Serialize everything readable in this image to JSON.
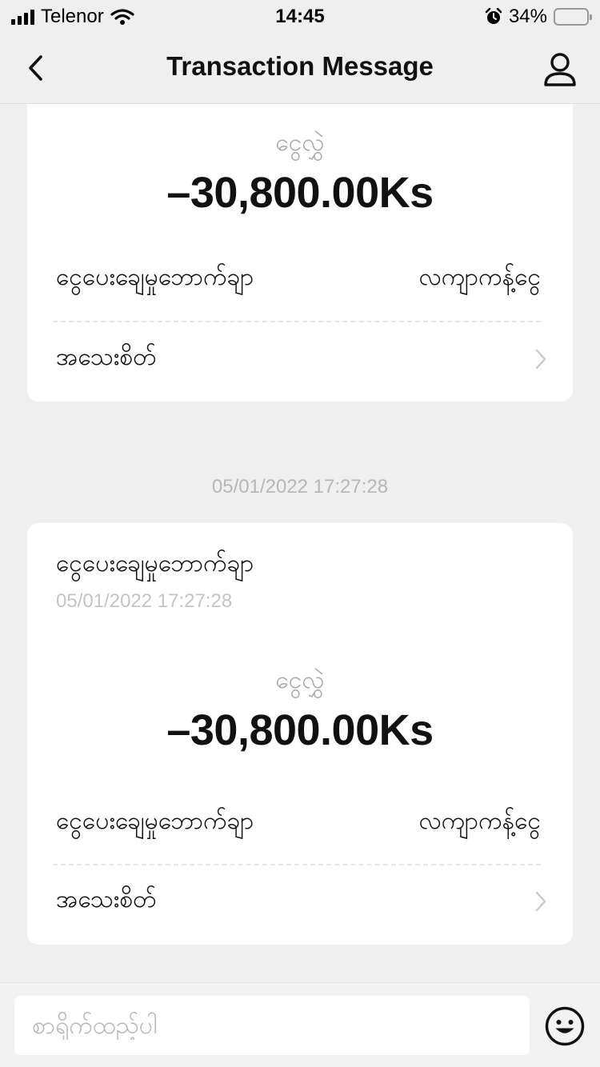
{
  "status_bar": {
    "carrier": "Telenor",
    "time": "14:45",
    "battery_percent": "34%",
    "battery_level": 0.34
  },
  "nav": {
    "title": "Transaction Message"
  },
  "cards": [
    {
      "amount_label": "ငွေလွှဲ",
      "amount": "–30,800.00Ks",
      "row_label": "ငွေပေးချေမှုဘောက်ချာ",
      "row_value": "လကျာကန့်ငွေ",
      "details_label": "အသေးစိတ်"
    },
    {
      "title": "ငွေပေးချေမှုဘောက်ချာ",
      "subtitle": "05/01/2022 17:27:28",
      "amount_label": "ငွေလွှဲ",
      "amount": "–30,800.00Ks",
      "row_label": "ငွေပေးချေမှုဘောက်ချာ",
      "row_value": "လကျာကန့်ငွေ",
      "details_label": "အသေးစိတ်"
    }
  ],
  "timestamp": "05/01/2022 17:27:28",
  "composer": {
    "placeholder": "စာရိုက်ထည့်ပါ"
  },
  "icons": {
    "back": "chevron-left-icon",
    "profile": "user-icon",
    "details": "chevron-right-icon",
    "emoji": "smiley-icon"
  }
}
